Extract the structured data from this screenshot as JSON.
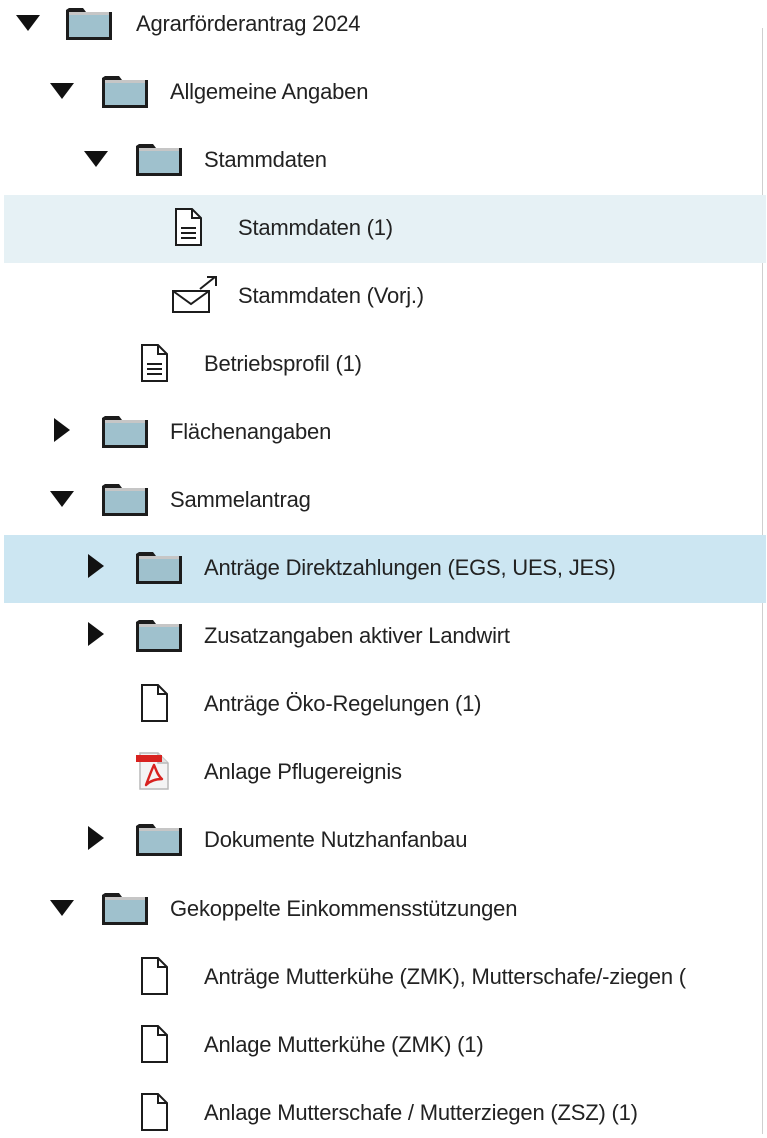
{
  "tree": {
    "items": [
      {
        "label": "Agrarförderantrag 2024",
        "icon": "folder-icon",
        "state": "expanded"
      },
      {
        "label": "Allgemeine Angaben",
        "icon": "folder-icon",
        "state": "expanded"
      },
      {
        "label": "Stammdaten",
        "icon": "folder-icon",
        "state": "expanded"
      },
      {
        "label": "Stammdaten (1)",
        "icon": "document-lines-icon",
        "state": "leaf",
        "highlight": "selected"
      },
      {
        "label": "Stammdaten (Vorj.)",
        "icon": "envelope-arrow-icon",
        "state": "leaf"
      },
      {
        "label": "Betriebsprofil (1)",
        "icon": "document-lines-icon",
        "state": "leaf"
      },
      {
        "label": "Flächenangaben",
        "icon": "folder-icon",
        "state": "collapsed"
      },
      {
        "label": "Sammelantrag",
        "icon": "folder-icon",
        "state": "expanded"
      },
      {
        "label": "Anträge Direktzahlungen (EGS, UES, JES)",
        "icon": "folder-icon",
        "state": "collapsed",
        "highlight": "hover"
      },
      {
        "label": "Zusatzangaben aktiver Landwirt",
        "icon": "folder-icon",
        "state": "collapsed"
      },
      {
        "label": "Anträge Öko-Regelungen (1)",
        "icon": "document-blank-icon",
        "state": "leaf"
      },
      {
        "label": "Anlage Pflugereignis",
        "icon": "pdf-icon",
        "state": "leaf"
      },
      {
        "label": "Dokumente Nutzhanfanbau",
        "icon": "folder-icon",
        "state": "collapsed"
      },
      {
        "label": "Gekoppelte Einkommensstützungen",
        "icon": "folder-icon",
        "state": "expanded"
      },
      {
        "label": "Anträge Mutterkühe (ZMK), Mutterschafe/-ziegen (",
        "icon": "document-blank-icon",
        "state": "leaf"
      },
      {
        "label": "Anlage Mutterkühe (ZMK) (1)",
        "icon": "document-blank-icon",
        "state": "leaf"
      },
      {
        "label": "Anlage Mutterschafe / Mutterziegen (ZSZ) (1)",
        "icon": "document-blank-icon",
        "state": "leaf"
      }
    ]
  },
  "colors": {
    "selected_row": "#e6f1f5",
    "hover_row": "#cce6f2",
    "folder_fill": "#9fc1cd",
    "folder_stroke": "#1c1c1c",
    "pdf_red": "#d8221f"
  }
}
